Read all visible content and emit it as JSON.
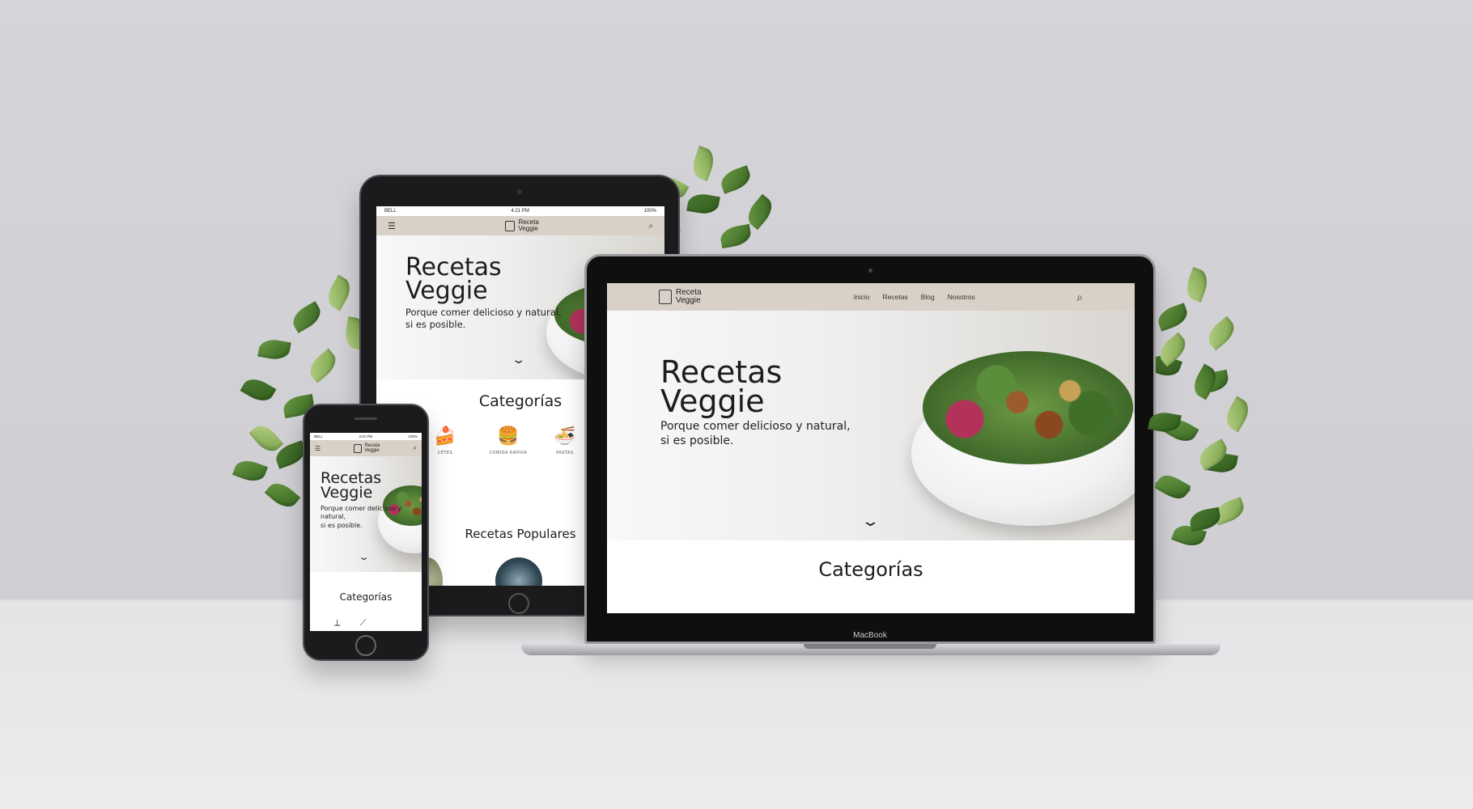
{
  "brand": {
    "line1": "Receta",
    "line2": "Veggie"
  },
  "hero": {
    "title_line1": "Recetas",
    "title_line2": "Veggie",
    "subtitle_line1": "Porque comer delicioso y natural,",
    "subtitle_line2": "si es posible.",
    "phone_subtitle_line1": "Porque comer delicioso y",
    "phone_subtitle_line2": "natural,",
    "phone_subtitle_line3": "si es posible."
  },
  "nav": {
    "items": [
      "Inicio",
      "Recetas",
      "Blog",
      "Nosotros"
    ]
  },
  "status": {
    "carrier": "BELL",
    "time": "4:21 PM",
    "battery": "100%"
  },
  "sections": {
    "categories": "Categorías",
    "popular": "Recetas Populares"
  },
  "categories": [
    {
      "label": "POSTRES",
      "icon": "cake-icon"
    },
    {
      "label": "COMIDA RÁPIDA",
      "icon": "burger-fries-icon"
    },
    {
      "label": "PASTAS",
      "icon": "noodles-icon"
    }
  ],
  "tablet_categories_visible": [
    "CETES",
    "COMIDA RÁPIDA",
    "PASTAS"
  ],
  "laptop": {
    "brand_label": "MacBook"
  },
  "colors": {
    "navbar": "#d9d1c7",
    "wall": "#d2d2d6",
    "floor": "#ebebed"
  }
}
